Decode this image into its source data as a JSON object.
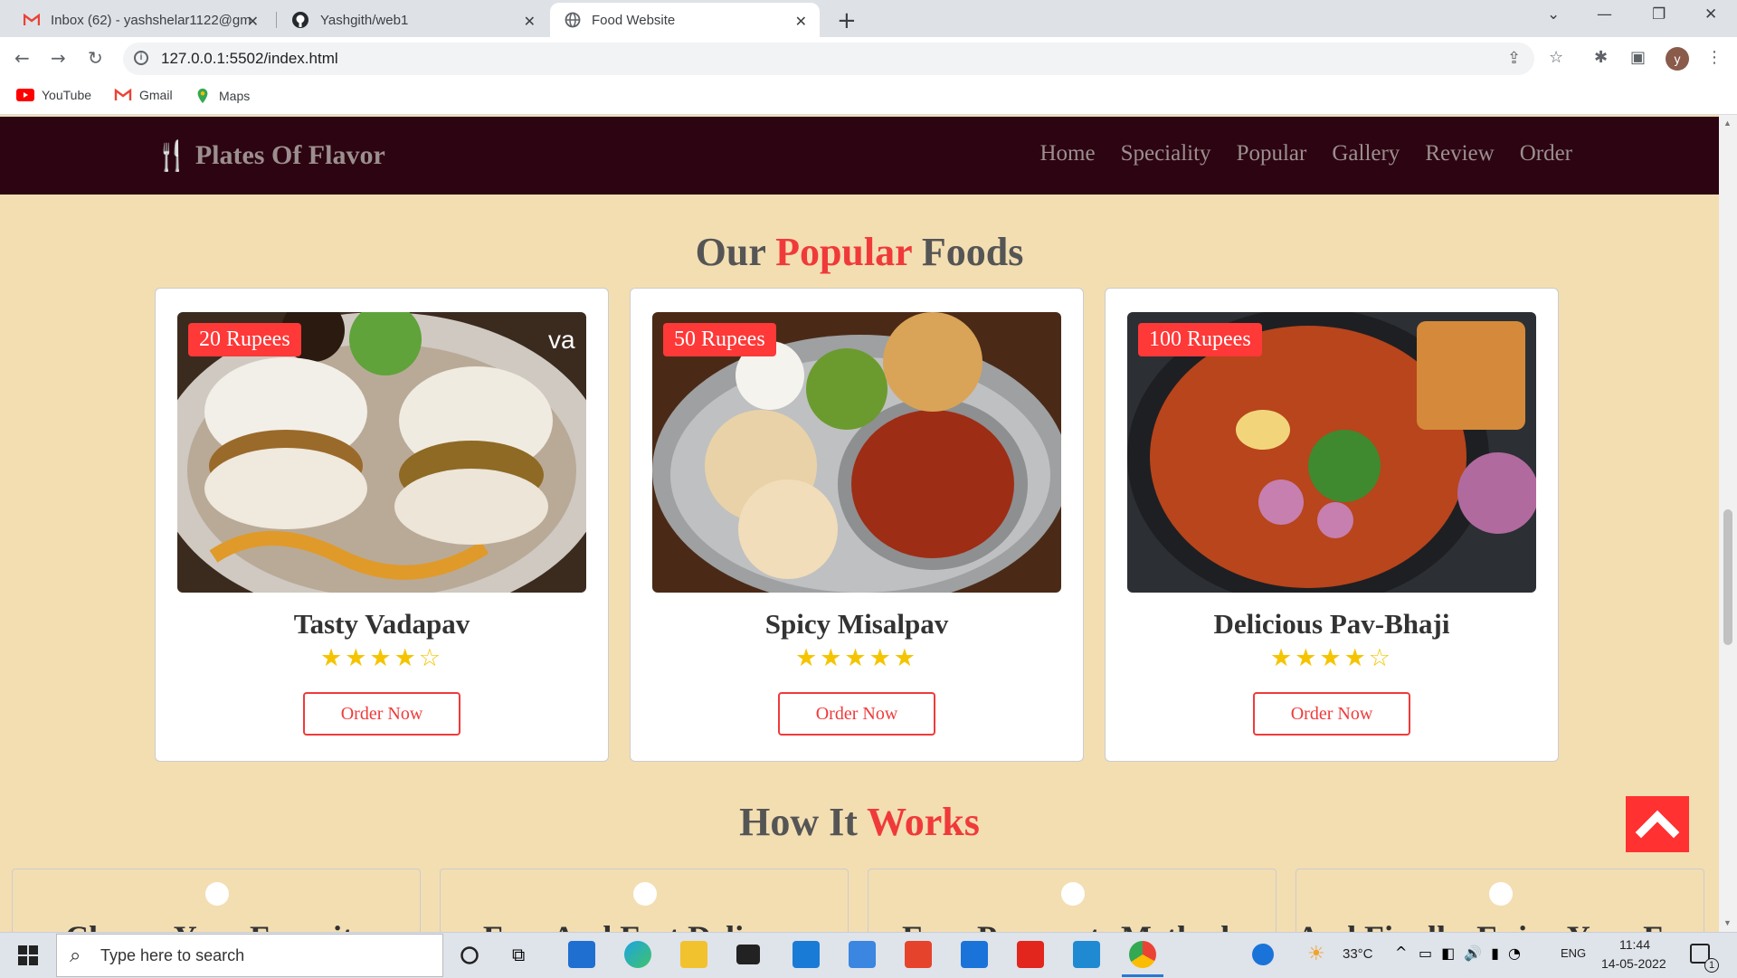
{
  "browser": {
    "tabs": [
      {
        "title": "Inbox (62) - yashshelar1122@gm",
        "close": "✕"
      },
      {
        "title": "Yashgith/web1",
        "close": "✕"
      },
      {
        "title": "Food Website",
        "close": "✕"
      }
    ],
    "new_tab": "+",
    "url": "127.0.0.1:5502/index.html",
    "profile_initial": "y",
    "bookmarks": [
      "YouTube",
      "Gmail",
      "Maps"
    ]
  },
  "site": {
    "logo": "Plates Of Flavor",
    "nav": [
      "Home",
      "Speciality",
      "Popular",
      "Gallery",
      "Review",
      "Order"
    ],
    "popular": {
      "title_before": "Our ",
      "title_accent": "Popular",
      "title_after": " Foods",
      "cards": [
        {
          "price": "20 Rupees",
          "name": "Tasty Vadapav",
          "rating": 4,
          "stars": "★★★★☆",
          "button": "Order Now"
        },
        {
          "price": "50 Rupees",
          "name": "Spicy Misalpav",
          "rating": 5,
          "stars": "★★★★★",
          "button": "Order Now"
        },
        {
          "price": "100 Rupees",
          "name": "Delicious Pav-Bhaji",
          "rating": 4,
          "stars": "★★★★☆",
          "button": "Order Now"
        }
      ]
    },
    "how": {
      "title_before": "How It ",
      "title_accent": "Works",
      "steps": [
        "Choose Your Favorite",
        "Free And Fast Delivery",
        "Easy Payments Methods",
        "And Finally, Enjoy Your Food"
      ]
    }
  },
  "taskbar": {
    "search_placeholder": "Type here to search",
    "temperature": "33°C",
    "language": "ENG",
    "time": "11:44",
    "date": "14-05-2022",
    "notification_count": "1"
  },
  "colors": {
    "accent": "#f03a3a",
    "header_bg": "#2d0412",
    "page_bg": "#f3deb2",
    "star": "#f5c400"
  }
}
